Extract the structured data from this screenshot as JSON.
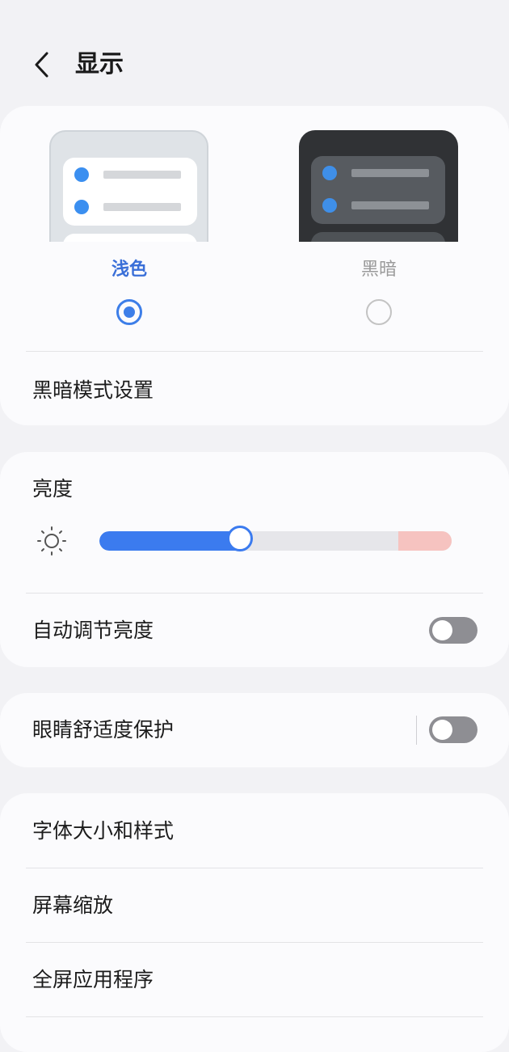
{
  "header": {
    "title": "显示",
    "back_icon": "chevron-left-icon"
  },
  "theme": {
    "options": [
      {
        "label": "浅色",
        "selected": true
      },
      {
        "label": "黑暗",
        "selected": false
      }
    ],
    "dark_mode_settings_label": "黑暗模式设置"
  },
  "brightness": {
    "title": "亮度",
    "icon": "sun-icon",
    "level": 0.4,
    "auto_label": "自动调节亮度",
    "auto_enabled": false
  },
  "eye_comfort": {
    "label": "眼睛舒适度保护",
    "enabled": false
  },
  "more": {
    "items": [
      {
        "label": "字体大小和样式"
      },
      {
        "label": "屏幕缩放"
      },
      {
        "label": "全屏应用程序"
      }
    ]
  },
  "colors": {
    "accent": "#3b7bef",
    "selected_label": "#3a6fd8",
    "toggle_off": "#8e8e93",
    "slider_warn": "#f6c3c0"
  }
}
